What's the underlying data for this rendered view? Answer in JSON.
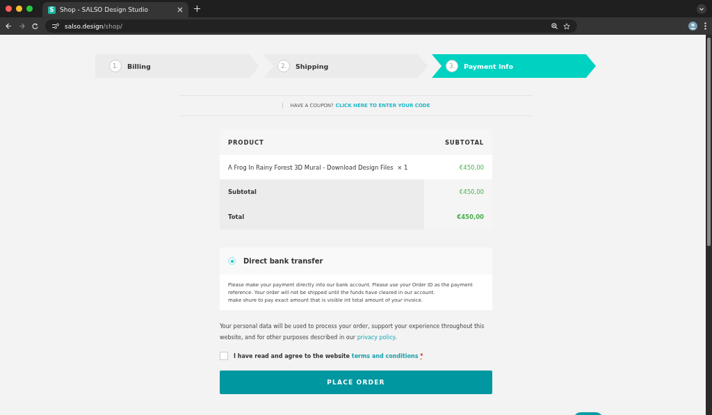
{
  "browser": {
    "tab_title": "Shop - SALSO Design Studio",
    "favicon_letter": "S",
    "url_host": "salso.design",
    "url_path": "/shop/"
  },
  "steps": [
    {
      "number": "1.",
      "label": "Billing",
      "selected": false
    },
    {
      "number": "2.",
      "label": "Shipping",
      "selected": false
    },
    {
      "number": "3.",
      "label": "Payment Info",
      "selected": true
    }
  ],
  "coupon": {
    "text": "HAVE A COUPON?",
    "link": "CLICK HERE TO ENTER YOUR CODE"
  },
  "order_table": {
    "columns": [
      "PRODUCT",
      "SUBTOTAL"
    ],
    "rows": [
      {
        "kind": "item",
        "label": "A Frog In Rainy Forest 3D Mural - Download Design Files",
        "quantity": "× 1",
        "value": "€450,00"
      },
      {
        "kind": "subtotal",
        "label": "Subtotal",
        "value": "€450,00"
      },
      {
        "kind": "total",
        "label": "Total",
        "value": "€450,00"
      }
    ]
  },
  "payment_method": {
    "label": "Direct bank transfer",
    "selected": true,
    "description": [
      "Please make your payment directly into our bank account. Please use your Order ID as the payment reference. Your order will not be shipped until the funds have cleared in our account.",
      "make shure to pay exact amount that is visible int total amount of your invoice."
    ]
  },
  "privacy": {
    "text": "Your personal data will be used to process your order, support your experience throughout this website, and for other purposes described in our",
    "link": "privacy policy",
    "end": "."
  },
  "terms": {
    "checked": false,
    "text": "I have read and agree to the website",
    "link": "terms and conditions",
    "required_mark": "*"
  },
  "place_order_button": "PLACE ORDER"
}
